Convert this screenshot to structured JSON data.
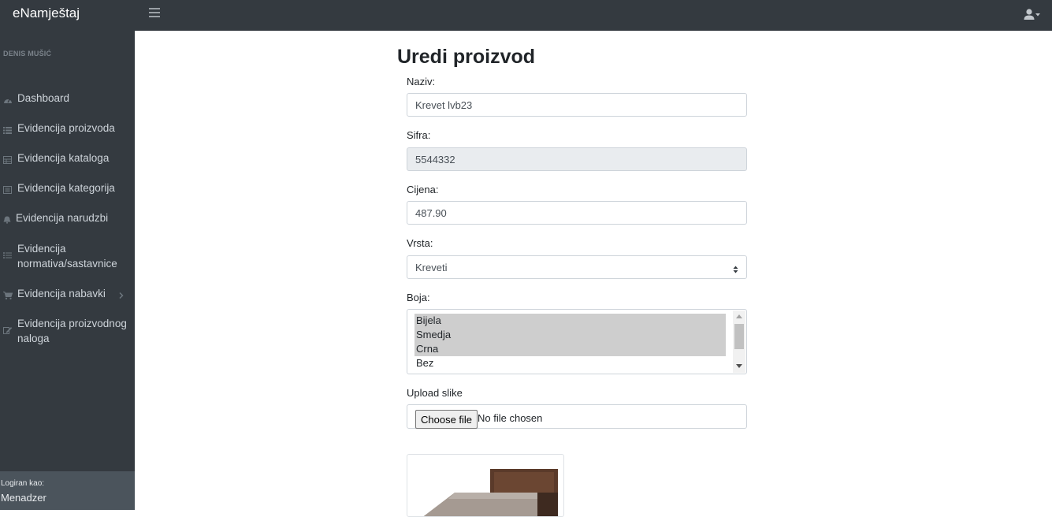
{
  "app": {
    "brand": "eNamještaj"
  },
  "sidebar": {
    "user_name": "DENIS MUŠIĆ",
    "items": [
      {
        "label": "Dashboard",
        "icon": "dashboard-icon"
      },
      {
        "label": "Evidencija proizvoda",
        "icon": "list-icon"
      },
      {
        "label": "Evidencija kataloga",
        "icon": "table-icon"
      },
      {
        "label": "Evidencija kategorija",
        "icon": "book-icon"
      },
      {
        "label": "Evidencija narudzbi",
        "icon": "bell-icon"
      },
      {
        "label": "Evidencija normativa/sastavnice",
        "icon": "list-ul-icon"
      },
      {
        "label": "Evidencija nabavki",
        "icon": "cart-icon"
      },
      {
        "label": "Evidencija proizvodnog naloga",
        "icon": "edit-icon"
      }
    ],
    "footer_label": "Logiran kao:",
    "footer_role": "Menadzer"
  },
  "form": {
    "title": "Uredi proizvod",
    "naziv_label": "Naziv:",
    "naziv_value": "Krevet lvb23",
    "sifra_label": "Sifra:",
    "sifra_value": "5544332",
    "cijena_label": "Cijena:",
    "cijena_value": "487.90",
    "vrsta_label": "Vrsta:",
    "vrsta_value": "Kreveti",
    "boja_label": "Boja:",
    "boja_options": [
      {
        "label": "Bijela",
        "selected": true
      },
      {
        "label": "Smedja",
        "selected": true
      },
      {
        "label": "Crna",
        "selected": true
      },
      {
        "label": "Bez",
        "selected": false
      }
    ],
    "upload_label": "Upload slike",
    "file_button": "Choose file",
    "file_status": "No file chosen"
  },
  "colors": {
    "sidebar_bg": "#343a40",
    "selected_option_bg": "#cecece",
    "readonly_bg": "#e9ecef"
  }
}
